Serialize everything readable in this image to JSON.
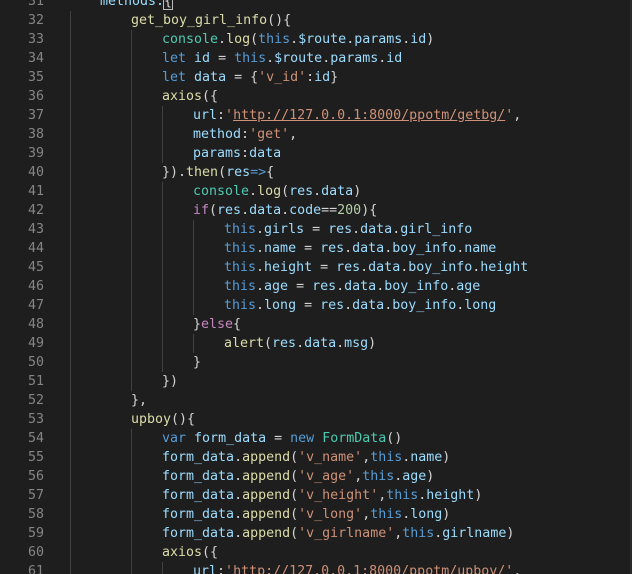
{
  "editor": {
    "lines": [
      {
        "n": "31",
        "indent": 0,
        "tokens": [
          {
            "t": "methods:",
            "c": "prop"
          },
          {
            "t": "{",
            "c": "punc",
            "box": true
          }
        ]
      },
      {
        "n": "32",
        "indent": 1,
        "tokens": [
          {
            "t": "get_boy_girl_info",
            "c": "fn"
          },
          {
            "t": "(){",
            "c": "punc"
          }
        ]
      },
      {
        "n": "33",
        "indent": 2,
        "tokens": [
          {
            "t": "console",
            "c": "typ"
          },
          {
            "t": ".",
            "c": "punc"
          },
          {
            "t": "log",
            "c": "fn"
          },
          {
            "t": "(",
            "c": "punc"
          },
          {
            "t": "this",
            "c": "kw"
          },
          {
            "t": ".",
            "c": "punc"
          },
          {
            "t": "$route",
            "c": "prop"
          },
          {
            "t": ".",
            "c": "punc"
          },
          {
            "t": "params",
            "c": "prop"
          },
          {
            "t": ".",
            "c": "punc"
          },
          {
            "t": "id",
            "c": "prop"
          },
          {
            "t": ")",
            "c": "punc"
          }
        ]
      },
      {
        "n": "34",
        "indent": 2,
        "tokens": [
          {
            "t": "let",
            "c": "kw"
          },
          {
            "t": " ",
            "c": "punc"
          },
          {
            "t": "id",
            "c": "prop"
          },
          {
            "t": " = ",
            "c": "punc"
          },
          {
            "t": "this",
            "c": "kw"
          },
          {
            "t": ".",
            "c": "punc"
          },
          {
            "t": "$route",
            "c": "prop"
          },
          {
            "t": ".",
            "c": "punc"
          },
          {
            "t": "params",
            "c": "prop"
          },
          {
            "t": ".",
            "c": "punc"
          },
          {
            "t": "id",
            "c": "prop"
          }
        ]
      },
      {
        "n": "35",
        "indent": 2,
        "tokens": [
          {
            "t": "let",
            "c": "kw"
          },
          {
            "t": " ",
            "c": "punc"
          },
          {
            "t": "data",
            "c": "prop"
          },
          {
            "t": " = {",
            "c": "punc"
          },
          {
            "t": "'v_id'",
            "c": "str"
          },
          {
            "t": ":",
            "c": "punc"
          },
          {
            "t": "id",
            "c": "prop"
          },
          {
            "t": "}",
            "c": "punc"
          }
        ]
      },
      {
        "n": "36",
        "indent": 2,
        "tokens": [
          {
            "t": "axios",
            "c": "fn"
          },
          {
            "t": "({",
            "c": "punc"
          }
        ]
      },
      {
        "n": "37",
        "indent": 3,
        "tokens": [
          {
            "t": "url",
            "c": "prop"
          },
          {
            "t": ":",
            "c": "punc"
          },
          {
            "t": "'",
            "c": "str"
          },
          {
            "t": "http://127.0.0.1:8000/ppotm/getbg/",
            "c": "str",
            "u": true
          },
          {
            "t": "'",
            "c": "str"
          },
          {
            "t": ",",
            "c": "punc"
          }
        ]
      },
      {
        "n": "38",
        "indent": 3,
        "tokens": [
          {
            "t": "method",
            "c": "prop"
          },
          {
            "t": ":",
            "c": "punc"
          },
          {
            "t": "'get'",
            "c": "str"
          },
          {
            "t": ",",
            "c": "punc"
          }
        ]
      },
      {
        "n": "39",
        "indent": 3,
        "tokens": [
          {
            "t": "params",
            "c": "prop"
          },
          {
            "t": ":",
            "c": "punc"
          },
          {
            "t": "data",
            "c": "prop"
          }
        ]
      },
      {
        "n": "40",
        "indent": 2,
        "tokens": [
          {
            "t": "}).",
            "c": "punc"
          },
          {
            "t": "then",
            "c": "fn"
          },
          {
            "t": "(",
            "c": "punc"
          },
          {
            "t": "res",
            "c": "prop"
          },
          {
            "t": "=>",
            "c": "kw"
          },
          {
            "t": "{",
            "c": "punc"
          }
        ]
      },
      {
        "n": "41",
        "indent": 3,
        "tokens": [
          {
            "t": "console",
            "c": "typ"
          },
          {
            "t": ".",
            "c": "punc"
          },
          {
            "t": "log",
            "c": "fn"
          },
          {
            "t": "(",
            "c": "punc"
          },
          {
            "t": "res",
            "c": "prop"
          },
          {
            "t": ".",
            "c": "punc"
          },
          {
            "t": "data",
            "c": "prop"
          },
          {
            "t": ")",
            "c": "punc"
          }
        ]
      },
      {
        "n": "42",
        "indent": 3,
        "tokens": [
          {
            "t": "if",
            "c": "ctl"
          },
          {
            "t": "(",
            "c": "punc"
          },
          {
            "t": "res",
            "c": "prop"
          },
          {
            "t": ".",
            "c": "punc"
          },
          {
            "t": "data",
            "c": "prop"
          },
          {
            "t": ".",
            "c": "punc"
          },
          {
            "t": "code",
            "c": "prop"
          },
          {
            "t": "==",
            "c": "punc"
          },
          {
            "t": "200",
            "c": "num"
          },
          {
            "t": "){",
            "c": "punc"
          }
        ]
      },
      {
        "n": "43",
        "indent": 4,
        "tokens": [
          {
            "t": "this",
            "c": "kw"
          },
          {
            "t": ".",
            "c": "punc"
          },
          {
            "t": "girls",
            "c": "prop"
          },
          {
            "t": " = ",
            "c": "punc"
          },
          {
            "t": "res",
            "c": "prop"
          },
          {
            "t": ".",
            "c": "punc"
          },
          {
            "t": "data",
            "c": "prop"
          },
          {
            "t": ".",
            "c": "punc"
          },
          {
            "t": "girl_info",
            "c": "prop"
          }
        ]
      },
      {
        "n": "44",
        "indent": 4,
        "tokens": [
          {
            "t": "this",
            "c": "kw"
          },
          {
            "t": ".",
            "c": "punc"
          },
          {
            "t": "name",
            "c": "prop"
          },
          {
            "t": " = ",
            "c": "punc"
          },
          {
            "t": "res",
            "c": "prop"
          },
          {
            "t": ".",
            "c": "punc"
          },
          {
            "t": "data",
            "c": "prop"
          },
          {
            "t": ".",
            "c": "punc"
          },
          {
            "t": "boy_info",
            "c": "prop"
          },
          {
            "t": ".",
            "c": "punc"
          },
          {
            "t": "name",
            "c": "prop"
          }
        ]
      },
      {
        "n": "45",
        "indent": 4,
        "tokens": [
          {
            "t": "this",
            "c": "kw"
          },
          {
            "t": ".",
            "c": "punc"
          },
          {
            "t": "height",
            "c": "prop"
          },
          {
            "t": " = ",
            "c": "punc"
          },
          {
            "t": "res",
            "c": "prop"
          },
          {
            "t": ".",
            "c": "punc"
          },
          {
            "t": "data",
            "c": "prop"
          },
          {
            "t": ".",
            "c": "punc"
          },
          {
            "t": "boy_info",
            "c": "prop"
          },
          {
            "t": ".",
            "c": "punc"
          },
          {
            "t": "height",
            "c": "prop"
          }
        ]
      },
      {
        "n": "46",
        "indent": 4,
        "tokens": [
          {
            "t": "this",
            "c": "kw"
          },
          {
            "t": ".",
            "c": "punc"
          },
          {
            "t": "age",
            "c": "prop"
          },
          {
            "t": " = ",
            "c": "punc"
          },
          {
            "t": "res",
            "c": "prop"
          },
          {
            "t": ".",
            "c": "punc"
          },
          {
            "t": "data",
            "c": "prop"
          },
          {
            "t": ".",
            "c": "punc"
          },
          {
            "t": "boy_info",
            "c": "prop"
          },
          {
            "t": ".",
            "c": "punc"
          },
          {
            "t": "age",
            "c": "prop"
          }
        ]
      },
      {
        "n": "47",
        "indent": 4,
        "tokens": [
          {
            "t": "this",
            "c": "kw"
          },
          {
            "t": ".",
            "c": "punc"
          },
          {
            "t": "long",
            "c": "prop"
          },
          {
            "t": " = ",
            "c": "punc"
          },
          {
            "t": "res",
            "c": "prop"
          },
          {
            "t": ".",
            "c": "punc"
          },
          {
            "t": "data",
            "c": "prop"
          },
          {
            "t": ".",
            "c": "punc"
          },
          {
            "t": "boy_info",
            "c": "prop"
          },
          {
            "t": ".",
            "c": "punc"
          },
          {
            "t": "long",
            "c": "prop"
          }
        ]
      },
      {
        "n": "48",
        "indent": 3,
        "tokens": [
          {
            "t": "}",
            "c": "punc"
          },
          {
            "t": "else",
            "c": "ctl"
          },
          {
            "t": "{",
            "c": "punc"
          }
        ]
      },
      {
        "n": "49",
        "indent": 4,
        "tokens": [
          {
            "t": "alert",
            "c": "fn"
          },
          {
            "t": "(",
            "c": "punc"
          },
          {
            "t": "res",
            "c": "prop"
          },
          {
            "t": ".",
            "c": "punc"
          },
          {
            "t": "data",
            "c": "prop"
          },
          {
            "t": ".",
            "c": "punc"
          },
          {
            "t": "msg",
            "c": "prop"
          },
          {
            "t": ")",
            "c": "punc"
          }
        ]
      },
      {
        "n": "50",
        "indent": 3,
        "tokens": [
          {
            "t": "}",
            "c": "punc"
          }
        ]
      },
      {
        "n": "51",
        "indent": 2,
        "tokens": [
          {
            "t": "})",
            "c": "punc"
          }
        ]
      },
      {
        "n": "52",
        "indent": 1,
        "tokens": [
          {
            "t": "},",
            "c": "punc"
          }
        ]
      },
      {
        "n": "53",
        "indent": 1,
        "tokens": [
          {
            "t": "upboy",
            "c": "fn"
          },
          {
            "t": "(){",
            "c": "punc"
          }
        ]
      },
      {
        "n": "54",
        "indent": 2,
        "tokens": [
          {
            "t": "var",
            "c": "kw"
          },
          {
            "t": " ",
            "c": "punc"
          },
          {
            "t": "form_data",
            "c": "prop"
          },
          {
            "t": " = ",
            "c": "punc"
          },
          {
            "t": "new",
            "c": "kw"
          },
          {
            "t": " ",
            "c": "punc"
          },
          {
            "t": "FormData",
            "c": "typ"
          },
          {
            "t": "()",
            "c": "punc"
          }
        ]
      },
      {
        "n": "55",
        "indent": 2,
        "tokens": [
          {
            "t": "form_data",
            "c": "prop"
          },
          {
            "t": ".",
            "c": "punc"
          },
          {
            "t": "append",
            "c": "fn"
          },
          {
            "t": "(",
            "c": "punc"
          },
          {
            "t": "'v_name'",
            "c": "str"
          },
          {
            "t": ",",
            "c": "punc"
          },
          {
            "t": "this",
            "c": "kw"
          },
          {
            "t": ".",
            "c": "punc"
          },
          {
            "t": "name",
            "c": "prop"
          },
          {
            "t": ")",
            "c": "punc"
          }
        ]
      },
      {
        "n": "56",
        "indent": 2,
        "tokens": [
          {
            "t": "form_data",
            "c": "prop"
          },
          {
            "t": ".",
            "c": "punc"
          },
          {
            "t": "append",
            "c": "fn"
          },
          {
            "t": "(",
            "c": "punc"
          },
          {
            "t": "'v_age'",
            "c": "str"
          },
          {
            "t": ",",
            "c": "punc"
          },
          {
            "t": "this",
            "c": "kw"
          },
          {
            "t": ".",
            "c": "punc"
          },
          {
            "t": "age",
            "c": "prop"
          },
          {
            "t": ")",
            "c": "punc"
          }
        ]
      },
      {
        "n": "57",
        "indent": 2,
        "tokens": [
          {
            "t": "form_data",
            "c": "prop"
          },
          {
            "t": ".",
            "c": "punc"
          },
          {
            "t": "append",
            "c": "fn"
          },
          {
            "t": "(",
            "c": "punc"
          },
          {
            "t": "'v_height'",
            "c": "str"
          },
          {
            "t": ",",
            "c": "punc"
          },
          {
            "t": "this",
            "c": "kw"
          },
          {
            "t": ".",
            "c": "punc"
          },
          {
            "t": "height",
            "c": "prop"
          },
          {
            "t": ")",
            "c": "punc"
          }
        ]
      },
      {
        "n": "58",
        "indent": 2,
        "tokens": [
          {
            "t": "form_data",
            "c": "prop"
          },
          {
            "t": ".",
            "c": "punc"
          },
          {
            "t": "append",
            "c": "fn"
          },
          {
            "t": "(",
            "c": "punc"
          },
          {
            "t": "'v_long'",
            "c": "str"
          },
          {
            "t": ",",
            "c": "punc"
          },
          {
            "t": "this",
            "c": "kw"
          },
          {
            "t": ".",
            "c": "punc"
          },
          {
            "t": "long",
            "c": "prop"
          },
          {
            "t": ")",
            "c": "punc"
          }
        ]
      },
      {
        "n": "59",
        "indent": 2,
        "tokens": [
          {
            "t": "form_data",
            "c": "prop"
          },
          {
            "t": ".",
            "c": "punc"
          },
          {
            "t": "append",
            "c": "fn"
          },
          {
            "t": "(",
            "c": "punc"
          },
          {
            "t": "'v_girlname'",
            "c": "str"
          },
          {
            "t": ",",
            "c": "punc"
          },
          {
            "t": "this",
            "c": "kw"
          },
          {
            "t": ".",
            "c": "punc"
          },
          {
            "t": "girlname",
            "c": "prop"
          },
          {
            "t": ")",
            "c": "punc"
          }
        ]
      },
      {
        "n": "60",
        "indent": 2,
        "tokens": [
          {
            "t": "axios",
            "c": "fn"
          },
          {
            "t": "({",
            "c": "punc"
          }
        ]
      },
      {
        "n": "61",
        "indent": 3,
        "tokens": [
          {
            "t": "url",
            "c": "prop"
          },
          {
            "t": ":",
            "c": "punc"
          },
          {
            "t": "'",
            "c": "str"
          },
          {
            "t": "http://127.0.0.1:8000/ppotm/upboy/",
            "c": "str",
            "u": true
          },
          {
            "t": "'",
            "c": "str"
          },
          {
            "t": ",",
            "c": "punc"
          }
        ]
      }
    ]
  },
  "colors": {
    "background": "#1e1e1e",
    "line_number": "#858585",
    "function": "#dcdcaa",
    "keyword": "#569cd6",
    "control": "#c586c0",
    "property": "#9cdcfe",
    "string": "#ce9178",
    "number": "#b5cea8",
    "type": "#4ec9b0",
    "punctuation": "#d4d4d4"
  }
}
